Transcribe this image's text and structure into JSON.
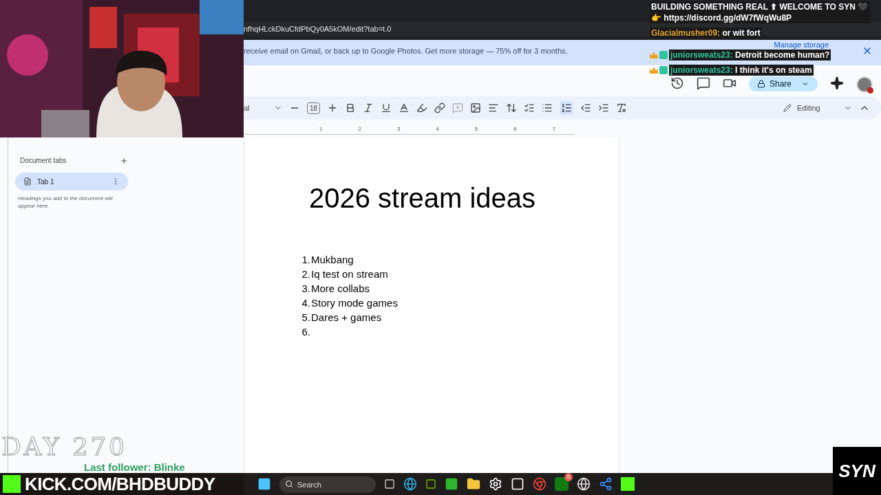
{
  "browser": {
    "url": "nfhqHLckDkuCfdPbQy0A5kOM/edit?tab=t.0"
  },
  "banner": {
    "text": "receive email on Gmail, or back up to Google Photos. Get more storage — 75% off for 3 months.",
    "action": "Manage storage"
  },
  "header": {
    "share": "Share"
  },
  "toolbar": {
    "font": "al",
    "font_size": "18",
    "mode": "Editing"
  },
  "ruler": [
    "1",
    "2",
    "3",
    "4",
    "5",
    "6",
    "7"
  ],
  "sidebar": {
    "title": "Document tabs",
    "tabs": [
      {
        "label": "Tab 1",
        "selected": true
      }
    ],
    "hint": "Headings you add to the document will appear here."
  },
  "document": {
    "title": "2026 stream ideas",
    "items": [
      {
        "number": "1.",
        "text": "Mukbang"
      },
      {
        "number": "2.",
        "text": "Iq test on stream"
      },
      {
        "number": "3.",
        "text": "More collabs"
      },
      {
        "number": "4.",
        "text": "Story mode games"
      },
      {
        "number": "5.",
        "text": "Dares + games"
      },
      {
        "number": "6."
      }
    ]
  },
  "chat": [
    {
      "text": "BUILDING SOMETHING REAL ⬆ WELCOME TO SYN 🖤 👉 https://discord.gg/dW7fWqWu8P",
      "color": "#ffffff"
    },
    {
      "user": "Glacialmusher09:",
      "text": "or wit fort",
      "color": "#e0a030"
    },
    {
      "user": "juniorsweats23:",
      "text": "Detroit become human?",
      "color": "#2ec4a0",
      "badge": true
    },
    {
      "user": "juniorsweats23:",
      "text": "I think it's on steam",
      "color": "#2ec4a0",
      "badge": true
    }
  ],
  "overlay": {
    "day": "DAY 270",
    "follower": "Last follower: Blinke",
    "channel": "KICK.COM/BHDBUDDY",
    "logo": "SYN"
  },
  "taskbar": {
    "search_placeholder": "Search",
    "xbox_badge": "5"
  }
}
